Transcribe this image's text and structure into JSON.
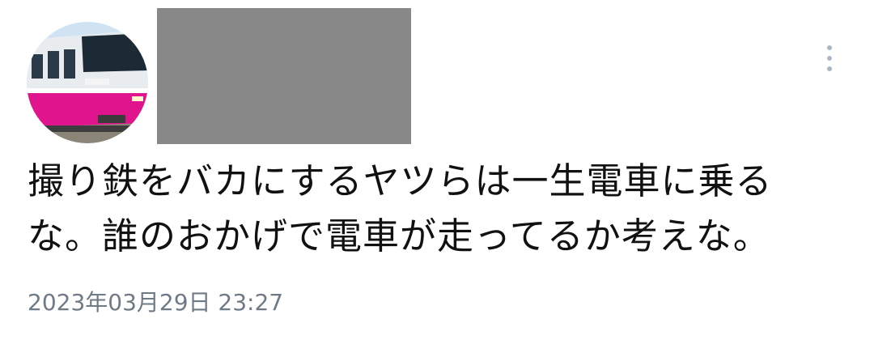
{
  "tweet": {
    "text_lines": [
      "撮り鉄をバカにするヤツらは一生電車に乗る",
      "な。誰のおかげで電車が走ってるか考えな。"
    ],
    "timestamp": "2023年03月29日 23:27"
  },
  "icons": {
    "menu": "more-vertical-icon"
  },
  "colors": {
    "redaction": "#888888",
    "menu_dots": "#a9b6c4",
    "timestamp": "#6e7a86",
    "train_pink": "#e0158d"
  }
}
